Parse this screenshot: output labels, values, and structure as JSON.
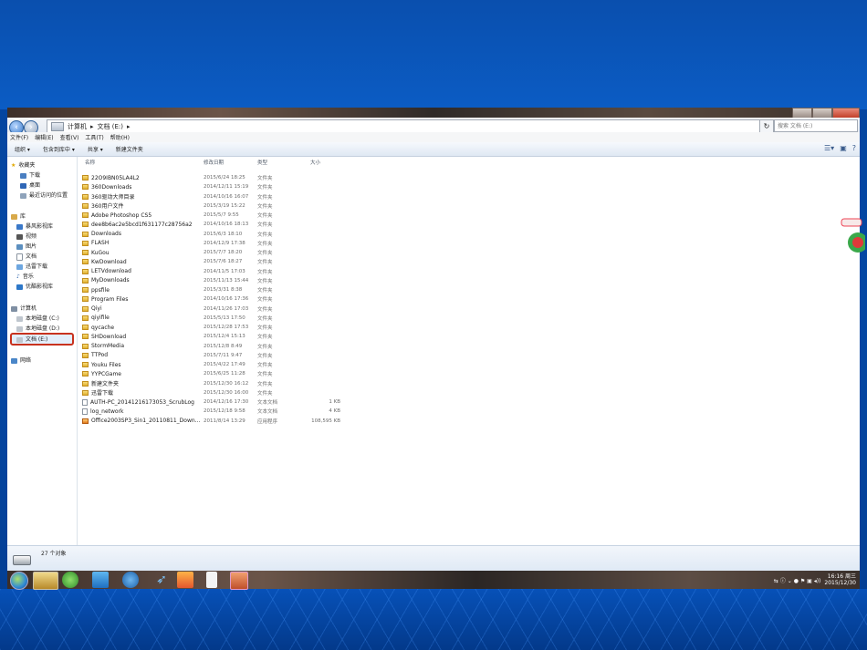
{
  "address": {
    "crumbs": [
      "计算机",
      "文档 (E:)"
    ],
    "search_placeholder": "搜索 文档 (E:)"
  },
  "menu": [
    "文件(F)",
    "编辑(E)",
    "查看(V)",
    "工具(T)",
    "帮助(H)"
  ],
  "toolbar": {
    "organize": "组织 ▾",
    "include_library": "包含到库中 ▾",
    "share": "共享 ▾",
    "new_folder": "新建文件夹"
  },
  "sidebar": {
    "favorites": "收藏夹",
    "fav_items": [
      "下载",
      "桌面",
      "最近访问的位置"
    ],
    "libraries": "库",
    "lib_items": [
      "暴风影视库",
      "视频",
      "图片",
      "文档",
      "迅雷下载",
      "音乐",
      "优酷影视库"
    ],
    "computer": "计算机",
    "drives": [
      "本地磁盘 (C:)",
      "本地磁盘 (D:)",
      "文档 (E:)"
    ],
    "network": "网络"
  },
  "columns": [
    "名称",
    "修改日期",
    "类型",
    "大小"
  ],
  "files": [
    {
      "name": "22O9IBN05LA4L2",
      "date": "2015/6/24 18:25",
      "type": "文件夹",
      "size": "",
      "kind": "folder"
    },
    {
      "name": "360Downloads",
      "date": "2014/12/11 15:19",
      "type": "文件夹",
      "size": "",
      "kind": "folder"
    },
    {
      "name": "360驱动大师目录",
      "date": "2014/10/16 16:07",
      "type": "文件夹",
      "size": "",
      "kind": "folder"
    },
    {
      "name": "360用户文件",
      "date": "2015/3/19 15:22",
      "type": "文件夹",
      "size": "",
      "kind": "folder"
    },
    {
      "name": "Adobe Photoshop CS5",
      "date": "2015/5/7 9:55",
      "type": "文件夹",
      "size": "",
      "kind": "folder"
    },
    {
      "name": "dee8b6ac2e5bcd1f631177c28756a2",
      "date": "2014/10/16 18:13",
      "type": "文件夹",
      "size": "",
      "kind": "folder"
    },
    {
      "name": "Downloads",
      "date": "2015/6/3 18:10",
      "type": "文件夹",
      "size": "",
      "kind": "folder"
    },
    {
      "name": "FLASH",
      "date": "2014/12/9 17:38",
      "type": "文件夹",
      "size": "",
      "kind": "folder"
    },
    {
      "name": "KuGou",
      "date": "2015/7/7 18:20",
      "type": "文件夹",
      "size": "",
      "kind": "folder"
    },
    {
      "name": "KwDownload",
      "date": "2015/7/6 18:27",
      "type": "文件夹",
      "size": "",
      "kind": "folder"
    },
    {
      "name": "LETVdownload",
      "date": "2014/11/5 17:03",
      "type": "文件夹",
      "size": "",
      "kind": "folder"
    },
    {
      "name": "MyDownloads",
      "date": "2015/11/13 15:44",
      "type": "文件夹",
      "size": "",
      "kind": "folder"
    },
    {
      "name": "ppsfile",
      "date": "2015/3/31 8:38",
      "type": "文件夹",
      "size": "",
      "kind": "folder"
    },
    {
      "name": "Program Files",
      "date": "2014/10/16 17:36",
      "type": "文件夹",
      "size": "",
      "kind": "folder"
    },
    {
      "name": "Qiyi",
      "date": "2014/11/26 17:03",
      "type": "文件夹",
      "size": "",
      "kind": "folder"
    },
    {
      "name": "qiyifile",
      "date": "2015/5/13 17:50",
      "type": "文件夹",
      "size": "",
      "kind": "folder"
    },
    {
      "name": "qycache",
      "date": "2015/12/28 17:53",
      "type": "文件夹",
      "size": "",
      "kind": "folder"
    },
    {
      "name": "SHDownload",
      "date": "2015/12/4 15:13",
      "type": "文件夹",
      "size": "",
      "kind": "folder"
    },
    {
      "name": "StormMedia",
      "date": "2015/12/8 8:49",
      "type": "文件夹",
      "size": "",
      "kind": "folder"
    },
    {
      "name": "TTPod",
      "date": "2015/7/11 9:47",
      "type": "文件夹",
      "size": "",
      "kind": "folder"
    },
    {
      "name": "Youku Files",
      "date": "2015/4/22 17:49",
      "type": "文件夹",
      "size": "",
      "kind": "folder"
    },
    {
      "name": "YYPCGame",
      "date": "2015/6/25 11:28",
      "type": "文件夹",
      "size": "",
      "kind": "folder"
    },
    {
      "name": "新建文件夹",
      "date": "2015/12/30 16:12",
      "type": "文件夹",
      "size": "",
      "kind": "folder"
    },
    {
      "name": "迅雷下载",
      "date": "2015/12/30 16:00",
      "type": "文件夹",
      "size": "",
      "kind": "folder"
    },
    {
      "name": "AUTH-PC_20141216173053_ScrubLog",
      "date": "2014/12/16 17:30",
      "type": "文本文档",
      "size": "1 KB",
      "kind": "doc"
    },
    {
      "name": "log_network",
      "date": "2015/12/18 9:58",
      "type": "文本文档",
      "size": "4 KB",
      "kind": "doc"
    },
    {
      "name": "Office2003SP3_Sin1_20110811_Down...",
      "date": "2011/8/14 13:29",
      "type": "应用程序",
      "size": "108,595 KB",
      "kind": "exe"
    }
  ],
  "status": "27 个对象",
  "clock": {
    "time": "16:16 周三",
    "date": "2015/12/30"
  }
}
